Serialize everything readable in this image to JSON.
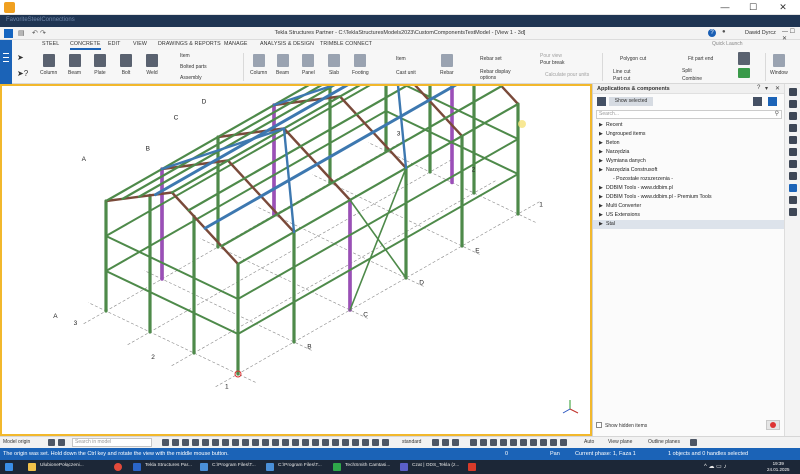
{
  "outer": {
    "subtitle": "FavoriteSteelConnections",
    "min": "—",
    "max": "☐",
    "close": "✕"
  },
  "title": {
    "text": "Tekla Structures Partner - C:\\TeklaStructuresModels2023\\CustomComponentsTestModel - [View 1 - 3d]",
    "user": "Dawid Dyrcz",
    "help": "?"
  },
  "menu": {
    "tabs": [
      "STEEL",
      "CONCRETE",
      "EDIT",
      "VIEW",
      "DRAWINGS & REPORTS",
      "MANAGE",
      "ANALYSIS & DESIGN",
      "TRIMBLE CONNECT"
    ],
    "active_tab": "CONCRETE",
    "quick_launch": "Quick Launch"
  },
  "ribbon": {
    "steel": [
      "Column",
      "Beam",
      "Plate",
      "Bolt",
      "Weld"
    ],
    "steel_small": [
      "Item",
      "Bolted parts",
      "Assembly"
    ],
    "concrete": [
      "Column",
      "Beam",
      "Panel",
      "Slab",
      "Footing"
    ],
    "cad": [
      "Item",
      "Cast unit"
    ],
    "rebar": "Rebar",
    "rebar_set": "Rebar set",
    "rebar_display": "Rebar display options",
    "pour_view": "Pour view",
    "pour_break": "Pour break",
    "calc_pour": "Calculate pour units",
    "cuts": [
      "Polygon cut",
      "Line cut",
      "Part cut"
    ],
    "fit": [
      "Fit part end",
      "Split",
      "Combine"
    ],
    "window": "Window"
  },
  "model": {
    "grid_labels": [
      "A",
      "B",
      "C",
      "D",
      "E",
      "1",
      "2",
      "3",
      "A",
      "B",
      "C",
      "D",
      "E",
      "1",
      "2",
      "3"
    ],
    "colors": {
      "steel_green": "#4e8a4a",
      "brace_purple": "#9b4fb8",
      "purlin_blue": "#3d78b0",
      "rafter_brown": "#7a4a3a",
      "frame_border": "#f2b82c"
    }
  },
  "panel": {
    "title": "Applications & components",
    "show_selected": "Show selected",
    "search_placeholder": "Search...",
    "items": [
      {
        "label": "Recent",
        "caret": "▶",
        "sub": false
      },
      {
        "label": "Ungrouped items",
        "caret": "▶",
        "sub": false
      },
      {
        "label": "Beton",
        "caret": "▶",
        "sub": false
      },
      {
        "label": "Narzędzia",
        "caret": "▶",
        "sub": false
      },
      {
        "label": "Wymiana danych",
        "caret": "▶",
        "sub": false
      },
      {
        "label": "Narzędzia Construsoft",
        "caret": "▶",
        "sub": false
      },
      {
        "label": "- Pozostałe rozszerzenia -",
        "caret": "",
        "sub": true
      },
      {
        "label": "DDBIM Tools - www.ddbim.pl",
        "caret": "▶",
        "sub": false
      },
      {
        "label": "DDBIM Tools - www.ddbim.pl - Premium Tools",
        "caret": "▶",
        "sub": false
      },
      {
        "label": "Multi Converter",
        "caret": "▶",
        "sub": false
      },
      {
        "label": "US Extensions",
        "caret": "▶",
        "sub": false
      },
      {
        "label": "Stal",
        "caret": "▶",
        "sub": false
      }
    ],
    "show_hidden": "Show hidden items"
  },
  "bottombar": {
    "model_origin": "Model origin",
    "search_model": "Search in model",
    "standard": "standard",
    "auto": "Auto",
    "view_plane": "View plane",
    "outline_planes": "Outline planes"
  },
  "status": {
    "message": "The origin was set. Hold down the Ctrl key and rotate the view with the middle mouse button.",
    "zero": "0",
    "pan": "Pan",
    "phase": "Current phase: 1, Faza 1",
    "selection": "1 objects and 0 handles selected"
  },
  "taskbar": {
    "items": [
      "UlubionePołączeni...",
      "Tekla Structures Par...",
      "C:\\Program Files\\T...",
      "C:\\Program Files\\T...",
      "TechSmith Camtasi...",
      "Czat | ODS_Tekla (z..."
    ],
    "time": "19:39",
    "date": "24.01.2025"
  }
}
